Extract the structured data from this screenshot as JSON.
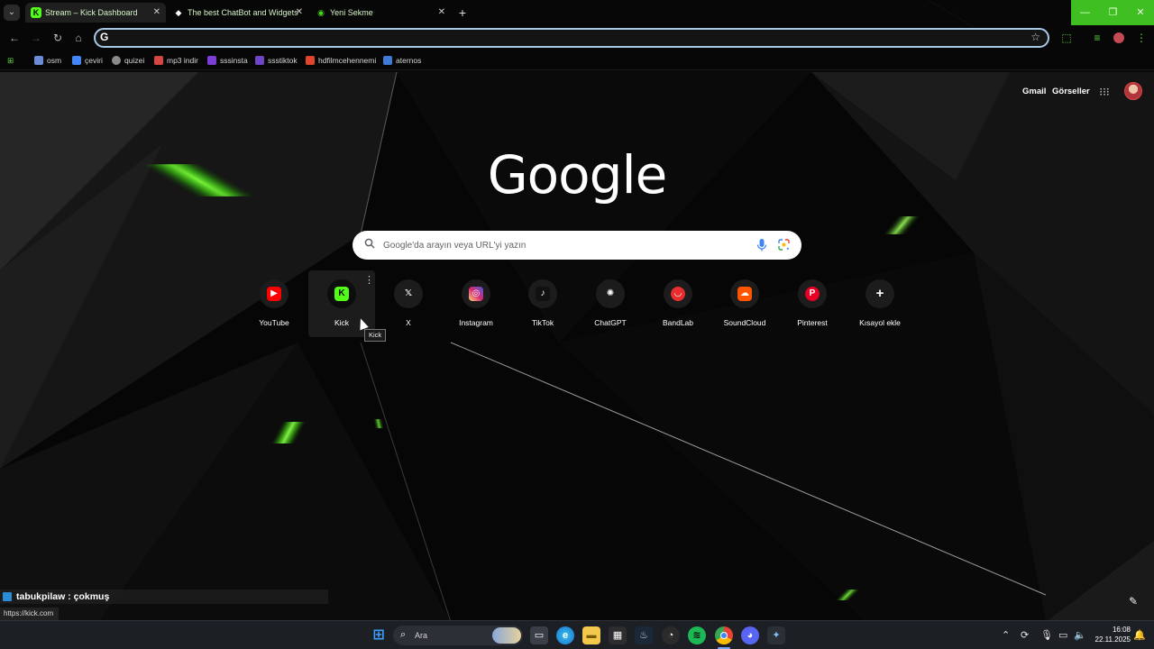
{
  "browser": {
    "tabs": [
      {
        "title": "Stream – Kick Dashboard",
        "favicon": "kick-icon",
        "active": true
      },
      {
        "title": "The best ChatBot and Widgets",
        "favicon": "diamond-icon",
        "active": false
      },
      {
        "title": "Yeni Sekme",
        "favicon": "chrome-icon",
        "active": false
      }
    ],
    "omnibox_value": "",
    "omnibox_prefix": "G",
    "bookmarks": [
      {
        "label": "osm",
        "color": "#6b8bd6"
      },
      {
        "label": "çeviri",
        "color": "#4285f4"
      },
      {
        "label": "quizei",
        "color": "#8a8a8a"
      },
      {
        "label": "mp3 indir",
        "color": "#d64541"
      },
      {
        "label": "sssinsta",
        "color": "#7b3fd6"
      },
      {
        "label": "ssstiktok",
        "color": "#6d46c8"
      },
      {
        "label": "hdfilmcehennemi",
        "color": "#e0442c"
      },
      {
        "label": "aternos",
        "color": "#3d7bd6"
      }
    ]
  },
  "newtab": {
    "links": {
      "gmail": "Gmail",
      "images": "Görseller"
    },
    "logo": "Google",
    "search_placeholder": "Google'da arayın veya URL'yi yazın",
    "shortcuts": [
      {
        "label": "YouTube",
        "icon": "youtube-icon",
        "color": "#ff0000",
        "glyph": "▶"
      },
      {
        "label": "Kick",
        "icon": "kick-icon",
        "color": "#53fc18",
        "glyph": "K"
      },
      {
        "label": "X",
        "icon": "x-icon",
        "color": "#000000",
        "glyph": "𝕏"
      },
      {
        "label": "Instagram",
        "icon": "instagram-icon",
        "color": "#d62976",
        "glyph": "◎"
      },
      {
        "label": "TikTok",
        "icon": "tiktok-icon",
        "color": "#111111",
        "glyph": "♪"
      },
      {
        "label": "ChatGPT",
        "icon": "chatgpt-icon",
        "color": "#1c1c1c",
        "glyph": "✺"
      },
      {
        "label": "BandLab",
        "icon": "bandlab-icon",
        "color": "#e62e2e",
        "glyph": "◡"
      },
      {
        "label": "SoundCloud",
        "icon": "soundcloud-icon",
        "color": "#ff5500",
        "glyph": "☁"
      },
      {
        "label": "Pinterest",
        "icon": "pinterest-icon",
        "color": "#e60023",
        "glyph": "P"
      },
      {
        "label": "Kısayol ekle",
        "icon": "plus-icon",
        "color": "#1c1c1c",
        "glyph": "+"
      }
    ],
    "tooltip": "Kick"
  },
  "overlay": {
    "chat_user": "tabukpilaw",
    "chat_message": "çokmuş",
    "status_url": "https://kick.com"
  },
  "taskbar": {
    "search_label": "Ara",
    "time": "16:08",
    "date": "22.11.2025"
  },
  "colors": {
    "accent_green": "#3fbf21",
    "omnibox_border": "#a9c8e8"
  }
}
